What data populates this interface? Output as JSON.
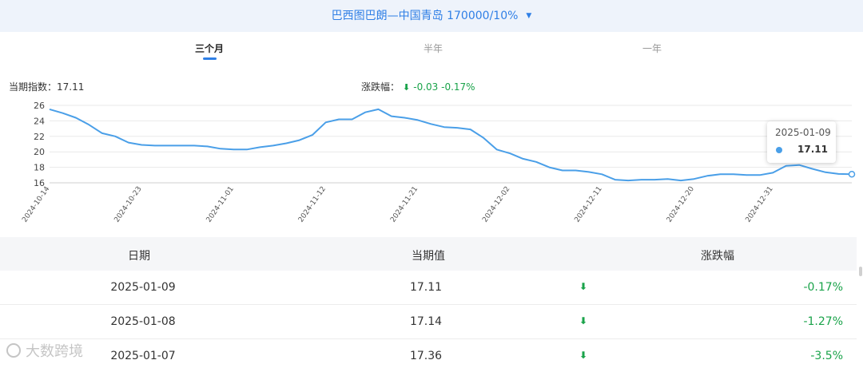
{
  "header": {
    "route_title": "巴西图巴朗—中国青岛 170000/10%"
  },
  "tabs": [
    {
      "label": "三个月",
      "active": true
    },
    {
      "label": "半年",
      "active": false
    },
    {
      "label": "一年",
      "active": false
    }
  ],
  "summary": {
    "current_label": "当期指数：",
    "current_value": "17.11",
    "change_label": "涨跌幅：",
    "change_value": "-0.03",
    "change_pct": "-0.17%"
  },
  "tooltip": {
    "date": "2025-01-09",
    "value": "17.11"
  },
  "chart_data": {
    "type": "line",
    "ylim": [
      16,
      26
    ],
    "yticks": [
      16,
      18,
      20,
      22,
      24,
      26
    ],
    "xtick_labels": [
      "2024-10-14",
      "2024-10-23",
      "2024-11-01",
      "2024-11-12",
      "2024-11-21",
      "2024-12-02",
      "2024-12-11",
      "2024-12-20",
      "2024-12-31"
    ],
    "x": [
      "2024-10-14",
      "2024-10-15",
      "2024-10-16",
      "2024-10-17",
      "2024-10-18",
      "2024-10-21",
      "2024-10-22",
      "2024-10-23",
      "2024-10-24",
      "2024-10-25",
      "2024-10-28",
      "2024-10-29",
      "2024-10-30",
      "2024-10-31",
      "2024-11-01",
      "2024-11-04",
      "2024-11-05",
      "2024-11-06",
      "2024-11-07",
      "2024-11-08",
      "2024-11-11",
      "2024-11-12",
      "2024-11-13",
      "2024-11-14",
      "2024-11-15",
      "2024-11-18",
      "2024-11-19",
      "2024-11-20",
      "2024-11-21",
      "2024-11-22",
      "2024-11-25",
      "2024-11-26",
      "2024-11-27",
      "2024-11-28",
      "2024-11-29",
      "2024-12-02",
      "2024-12-03",
      "2024-12-04",
      "2024-12-05",
      "2024-12-06",
      "2024-12-09",
      "2024-12-10",
      "2024-12-11",
      "2024-12-12",
      "2024-12-13",
      "2024-12-16",
      "2024-12-17",
      "2024-12-18",
      "2024-12-19",
      "2024-12-20",
      "2024-12-23",
      "2024-12-24",
      "2024-12-26",
      "2024-12-27",
      "2024-12-30",
      "2024-12-31",
      "2025-01-02",
      "2025-01-03",
      "2025-01-06",
      "2025-01-07",
      "2025-01-08",
      "2025-01-09"
    ],
    "series": [
      {
        "values": [
          25.5,
          25.0,
          24.4,
          23.5,
          22.4,
          22.0,
          21.2,
          20.9,
          20.8,
          20.8,
          20.8,
          20.8,
          20.7,
          20.4,
          20.3,
          20.3,
          20.6,
          20.8,
          21.1,
          21.5,
          22.2,
          23.8,
          24.2,
          24.2,
          25.1,
          25.5,
          24.6,
          24.4,
          24.1,
          23.6,
          23.2,
          23.1,
          22.9,
          21.8,
          20.3,
          19.8,
          19.1,
          18.7,
          18.0,
          17.6,
          17.6,
          17.4,
          17.1,
          16.4,
          16.3,
          16.4,
          16.4,
          16.5,
          16.3,
          16.5,
          16.9,
          17.1,
          17.1,
          17.0,
          17.0,
          17.3,
          18.2,
          18.3,
          17.8,
          17.36,
          17.14,
          17.11
        ]
      }
    ]
  },
  "table": {
    "headers": [
      "日期",
      "当期值",
      "涨跌幅"
    ],
    "rows": [
      {
        "date": "2025-01-09",
        "value": "17.11",
        "pct": "-0.17%"
      },
      {
        "date": "2025-01-08",
        "value": "17.14",
        "pct": "-1.27%"
      },
      {
        "date": "2025-01-07",
        "value": "17.36",
        "pct": "-3.5%"
      }
    ]
  },
  "watermark": "大数跨境",
  "colors": {
    "accent": "#2f7fe6",
    "line": "#4a9fe8",
    "down": "#1aa34a"
  },
  "icons": {
    "dropdown": "caret-down-icon",
    "change": "arrow-down-icon"
  }
}
